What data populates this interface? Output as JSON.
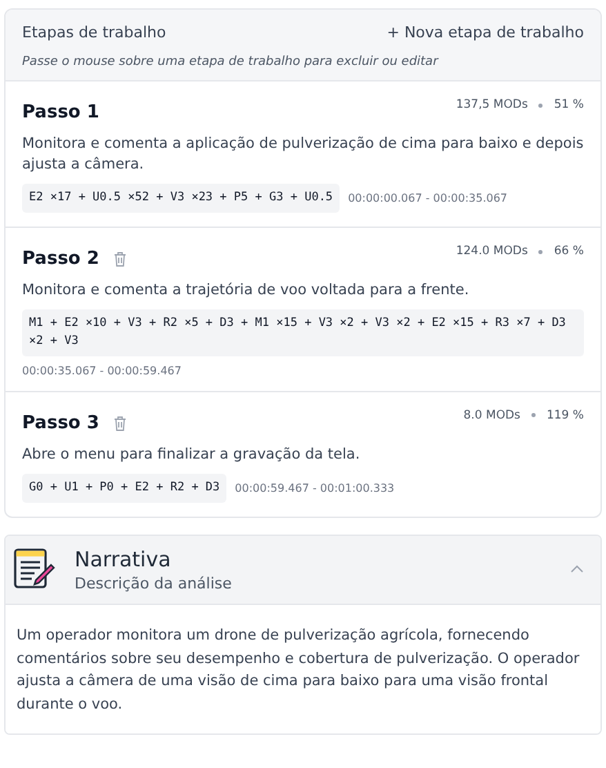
{
  "work_steps": {
    "title": "Etapas de trabalho",
    "add_button": "+ Nova etapa de trabalho",
    "hint": "Passe o mouse sobre uma etapa de trabalho para excluir ou editar",
    "steps": [
      {
        "title": "Passo 1",
        "delete_icon": false,
        "mods": "137,5 MODs",
        "percent": "51 %",
        "description": "Monitora e comenta a aplicação de pulverização de cima para baixo e depois ajusta a câmera.",
        "code": "E2 ×17 + U0.5 ×52 + V3 ×23 + P5 + G3 + U0.5",
        "time": "00:00:00.067 - 00:00:35.067"
      },
      {
        "title": "Passo 2",
        "delete_icon": true,
        "mods": "124.0 MODs",
        "percent": "66 %",
        "description": "Monitora e comenta a trajetória de voo voltada para a frente.",
        "code": "M1 + E2 ×10 + V3 + R2 ×5 + D3 + M1 ×15 + V3 ×2 + V3 ×2 + E2 ×15 + R3 ×7 + D3 ×2 + V3",
        "time": "00:00:35.067 - 00:00:59.467"
      },
      {
        "title": "Passo 3",
        "delete_icon": true,
        "mods": "8.0 MODs",
        "percent": "119 %",
        "description": "Abre o menu para finalizar a gravação da tela.",
        "code": "G0 + U1 + P0 + E2 + R2 + D3",
        "time": "00:00:59.467 - 00:01:00.333"
      }
    ]
  },
  "narrative": {
    "title": "Narrativa",
    "subtitle": "Descrição da análise",
    "expanded": true,
    "text": "Um operador monitora um drone de pulverização agrícola, fornecendo comentários sobre seu desempenho e cobertura de pulverização. O operador ajusta a câmera de uma visão de cima para baixo para uma visão frontal durante o voo."
  }
}
